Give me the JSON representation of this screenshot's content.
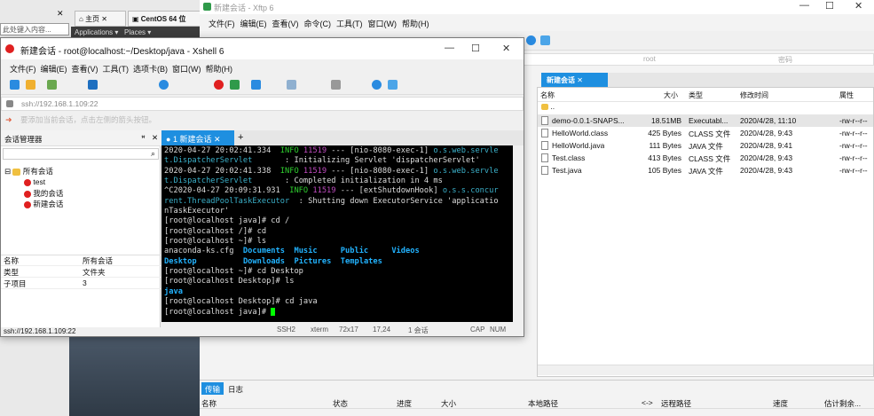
{
  "browser": {
    "address_text": "此处键入内容...",
    "tab_home": "主页",
    "tab_centos": "CentOS 64 位",
    "gnome_applications": "Applications",
    "gnome_places": "Places"
  },
  "xftp": {
    "title": "新建会话 - Xftp 6",
    "menu": [
      "文件(F)",
      "编辑(E)",
      "查看(V)",
      "命令(C)",
      "工具(T)",
      "窗口(W)",
      "帮助(H)"
    ],
    "addr_user": "root",
    "addr_pass": "密码",
    "remote_tab": "新建会话",
    "columns": [
      "名称",
      "大小",
      "类型",
      "修改时间",
      "属性"
    ],
    "parent_dir": "..",
    "files": [
      {
        "name": "demo-0.0.1-SNAPS...",
        "size": "18.51MB",
        "type": "Executabl...",
        "mtime": "2020/4/28, 11:10",
        "attr": "-rw-r--r--",
        "selected": true
      },
      {
        "name": "HelloWorld.class",
        "size": "425 Bytes",
        "type": "CLASS 文件",
        "mtime": "2020/4/28, 9:43",
        "attr": "-rw-r--r--",
        "selected": false
      },
      {
        "name": "HelloWorld.java",
        "size": "111 Bytes",
        "type": "JAVA 文件",
        "mtime": "2020/4/28, 9:41",
        "attr": "-rw-r--r--",
        "selected": false
      },
      {
        "name": "Test.class",
        "size": "413 Bytes",
        "type": "CLASS 文件",
        "mtime": "2020/4/28, 9:43",
        "attr": "-rw-r--r--",
        "selected": false
      },
      {
        "name": "Test.java",
        "size": "105 Bytes",
        "type": "JAVA 文件",
        "mtime": "2020/4/28, 9:43",
        "attr": "-rw-r--r--",
        "selected": false
      }
    ],
    "bottom_tabs": [
      "传输",
      "日志"
    ],
    "transfer_columns": [
      "名称",
      "状态",
      "进度",
      "大小",
      "本地路径",
      "<->",
      "远程路径",
      "速度",
      "估计剩余..."
    ]
  },
  "xshell": {
    "title": "新建会话 - root@localhost:~/Desktop/java - Xshell 6",
    "menu": [
      "文件(F)",
      "编辑(E)",
      "查看(V)",
      "工具(T)",
      "选项卡(B)",
      "窗口(W)",
      "帮助(H)"
    ],
    "address": "ssh://192.168.1.109:22",
    "hint": "要添加当前会话，点击左侧的箭头按钮。",
    "session_manager": "会话管理器",
    "tree": {
      "root": "所有会话",
      "items": [
        "test",
        "我的会话",
        "新建会话"
      ]
    },
    "props": [
      [
        "名称",
        "所有会话"
      ],
      [
        "类型",
        "文件夹"
      ],
      [
        "子项目",
        "3"
      ]
    ],
    "status_addr": "ssh://192.168.1.109:22",
    "term_tab": "1 新建会话",
    "status": {
      "proto": "SSH2",
      "term": "xterm",
      "size": "72x17",
      "pos": "17,24",
      "sessions": "1 会话",
      "caps": "CAP",
      "num": "NUM"
    }
  },
  "terminal": {
    "lines": [
      [
        [
          "w",
          "2020-04-27 20:02:41.334  "
        ],
        [
          "g",
          "INFO"
        ],
        [
          "p",
          " 11519"
        ],
        [
          "w",
          " --- [nio-8080-exec-1] "
        ],
        [
          "t",
          "o.s.web.servle"
        ]
      ],
      [
        [
          "t",
          "t.DispatcherServlet"
        ],
        [
          "w",
          "       : Initializing Servlet 'dispatcherServlet'"
        ]
      ],
      [
        [
          "w",
          "2020-04-27 20:02:41.338  "
        ],
        [
          "g",
          "INFO"
        ],
        [
          "p",
          " 11519"
        ],
        [
          "w",
          " --- [nio-8080-exec-1] "
        ],
        [
          "t",
          "o.s.web.servle"
        ]
      ],
      [
        [
          "t",
          "t.DispatcherServlet"
        ],
        [
          "w",
          "       : Completed initialization in 4 ms"
        ]
      ],
      [
        [
          "w",
          "^C2020-04-27 20:09:31.931  "
        ],
        [
          "g",
          "INFO"
        ],
        [
          "p",
          " 11519"
        ],
        [
          "w",
          " --- [extShutdownHook] "
        ],
        [
          "t",
          "o.s.s.concur"
        ]
      ],
      [
        [
          "t",
          "rent.ThreadPoolTaskExecutor"
        ],
        [
          "w",
          "  : Shutting down ExecutorService 'applicatio"
        ]
      ],
      [
        [
          "w",
          "nTaskExecutor'"
        ]
      ],
      [
        [
          "w",
          "[root@localhost java]# cd /"
        ]
      ],
      [
        [
          "w",
          "[root@localhost /]# cd"
        ]
      ],
      [
        [
          "w",
          "[root@localhost ~]# ls"
        ]
      ],
      [
        [
          "w",
          "anaconda-ks.cfg  "
        ],
        [
          "b",
          "Documents"
        ],
        [
          "w",
          "  "
        ],
        [
          "b",
          "Music"
        ],
        [
          "w",
          "     "
        ],
        [
          "b",
          "Public"
        ],
        [
          "w",
          "     "
        ],
        [
          "b",
          "Videos"
        ]
      ],
      [
        [
          "b",
          "Desktop"
        ],
        [
          "w",
          "          "
        ],
        [
          "b",
          "Downloads"
        ],
        [
          "w",
          "  "
        ],
        [
          "b",
          "Pictures"
        ],
        [
          "w",
          "  "
        ],
        [
          "b",
          "Templates"
        ]
      ],
      [
        [
          "w",
          "[root@localhost ~]# cd Desktop"
        ]
      ],
      [
        [
          "w",
          "[root@localhost Desktop]# ls"
        ]
      ],
      [
        [
          "b",
          "java"
        ]
      ],
      [
        [
          "w",
          "[root@localhost Desktop]# cd java"
        ]
      ],
      [
        [
          "w",
          "[root@localhost java]# "
        ],
        [
          "cursor",
          ""
        ]
      ]
    ]
  }
}
